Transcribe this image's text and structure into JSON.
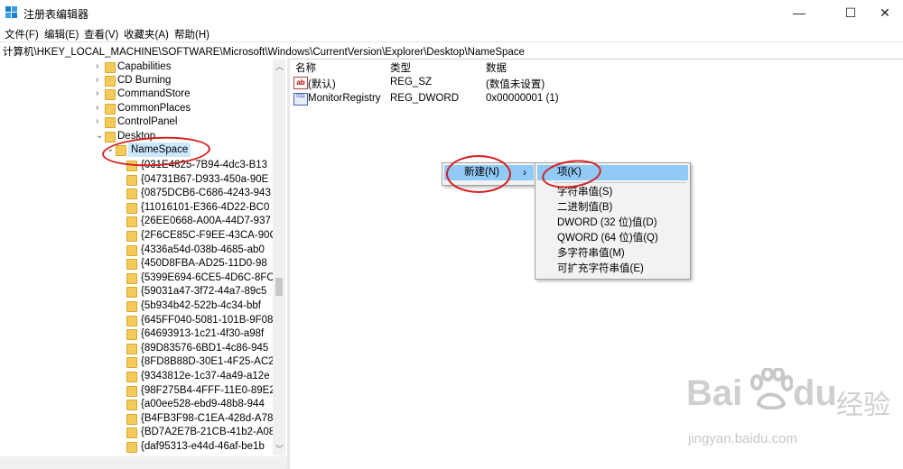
{
  "window": {
    "title": "注册表编辑器",
    "minimize_glyph": "—",
    "maximize_glyph": "☐",
    "close_glyph": "✕"
  },
  "menu": [
    "文件(F)",
    "编辑(E)",
    "查看(V)",
    "收藏夹(A)",
    "帮助(H)"
  ],
  "address": "计算机\\HKEY_LOCAL_MACHINE\\SOFTWARE\\Microsoft\\Windows\\CurrentVersion\\Explorer\\Desktop\\NameSpace",
  "tree": {
    "parents": [
      "Capabilities",
      "CD Burning",
      "CommandStore",
      "CommonPlaces",
      "ControlPanel",
      "Desktop"
    ],
    "selected": "NameSpace",
    "children": [
      "{031E4825-7B94-4dc3-B13",
      "{04731B67-D933-450a-90E",
      "{0875DCB6-C686-4243-943",
      "{11016101-E366-4D22-BC0",
      "{26EE0668-A00A-44D7-937",
      "{2F6CE85C-F9EE-43CA-90C",
      "{4336a54d-038b-4685-ab0",
      "{450D8FBA-AD25-11D0-98",
      "{5399E694-6CE5-4D6C-8FC",
      "{59031a47-3f72-44a7-89c5",
      "{5b934b42-522b-4c34-bbf",
      "{645FF040-5081-101B-9F08",
      "{64693913-1c21-4f30-a98f",
      "{89D83576-6BD1-4c86-945",
      "{8FD8B88D-30E1-4F25-AC2",
      "{9343812e-1c37-4a49-a12e",
      "{98F275B4-4FFF-11E0-89E2",
      "{a00ee528-ebd9-48b8-944",
      "{B4FB3F98-C1EA-428d-A78",
      "{BD7A2E7B-21CB-41b2-A08",
      "{daf95313-e44d-46af-be1b"
    ],
    "expand_glyph": "›",
    "collapse_glyph": "⌄"
  },
  "list": {
    "headers": {
      "name": "名称",
      "type": "类型",
      "data": "数据"
    },
    "rows": [
      {
        "icon": "string-value-icon",
        "icon_text": "ab",
        "name": "(默认)",
        "type": "REG_SZ",
        "data": "(数值未设置)"
      },
      {
        "icon": "binary-value-icon",
        "icon_text": "011",
        "name": "MonitorRegistry",
        "type": "REG_DWORD",
        "data": "0x00000001 (1)"
      }
    ]
  },
  "context_menu": {
    "new_label": "新建(N)",
    "submenu_arrow": "›",
    "submenu": [
      "项(K)",
      "字符串值(S)",
      "二进制值(B)",
      "DWORD (32 位)值(D)",
      "QWORD (64 位)值(Q)",
      "多字符串值(M)",
      "可扩充字符串值(E)"
    ]
  },
  "watermark": {
    "brand": "Bai",
    "brand2": "du",
    "cn": "经验",
    "url": "jingyan.baidu.com"
  },
  "colors": {
    "selection": "#cce8ff",
    "menu_highlight": "#91c9f7",
    "folder": "#f4cb5a",
    "annotation": "#d42020"
  }
}
